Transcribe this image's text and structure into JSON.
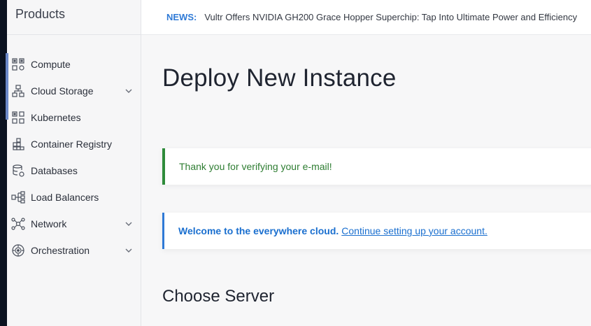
{
  "sidebar": {
    "title": "Products",
    "items": [
      {
        "label": "Compute",
        "icon": "compute-icon",
        "expandable": false
      },
      {
        "label": "Cloud Storage",
        "icon": "cloud-storage-icon",
        "expandable": true
      },
      {
        "label": "Kubernetes",
        "icon": "kubernetes-icon",
        "expandable": false
      },
      {
        "label": "Container Registry",
        "icon": "container-registry-icon",
        "expandable": false
      },
      {
        "label": "Databases",
        "icon": "databases-icon",
        "expandable": false
      },
      {
        "label": "Load Balancers",
        "icon": "load-balancers-icon",
        "expandable": false
      },
      {
        "label": "Network",
        "icon": "network-icon",
        "expandable": true
      },
      {
        "label": "Orchestration",
        "icon": "orchestration-icon",
        "expandable": true
      }
    ]
  },
  "news": {
    "label": "NEWS:",
    "text": "Vultr Offers NVIDIA GH200 Grace Hopper Superchip: Tap Into Ultimate Power and Efficiency"
  },
  "main": {
    "title": "Deploy New Instance",
    "success_alert": "Thank you for verifying your e-mail!",
    "info_alert": {
      "strong": "Welcome to the everywhere cloud.",
      "link": "Continue setting up your account."
    },
    "section_title": "Choose Server"
  },
  "colors": {
    "accent": "#2f7ad6",
    "success": "#2e8b3a",
    "sidebar_active": "#6c89c9"
  }
}
